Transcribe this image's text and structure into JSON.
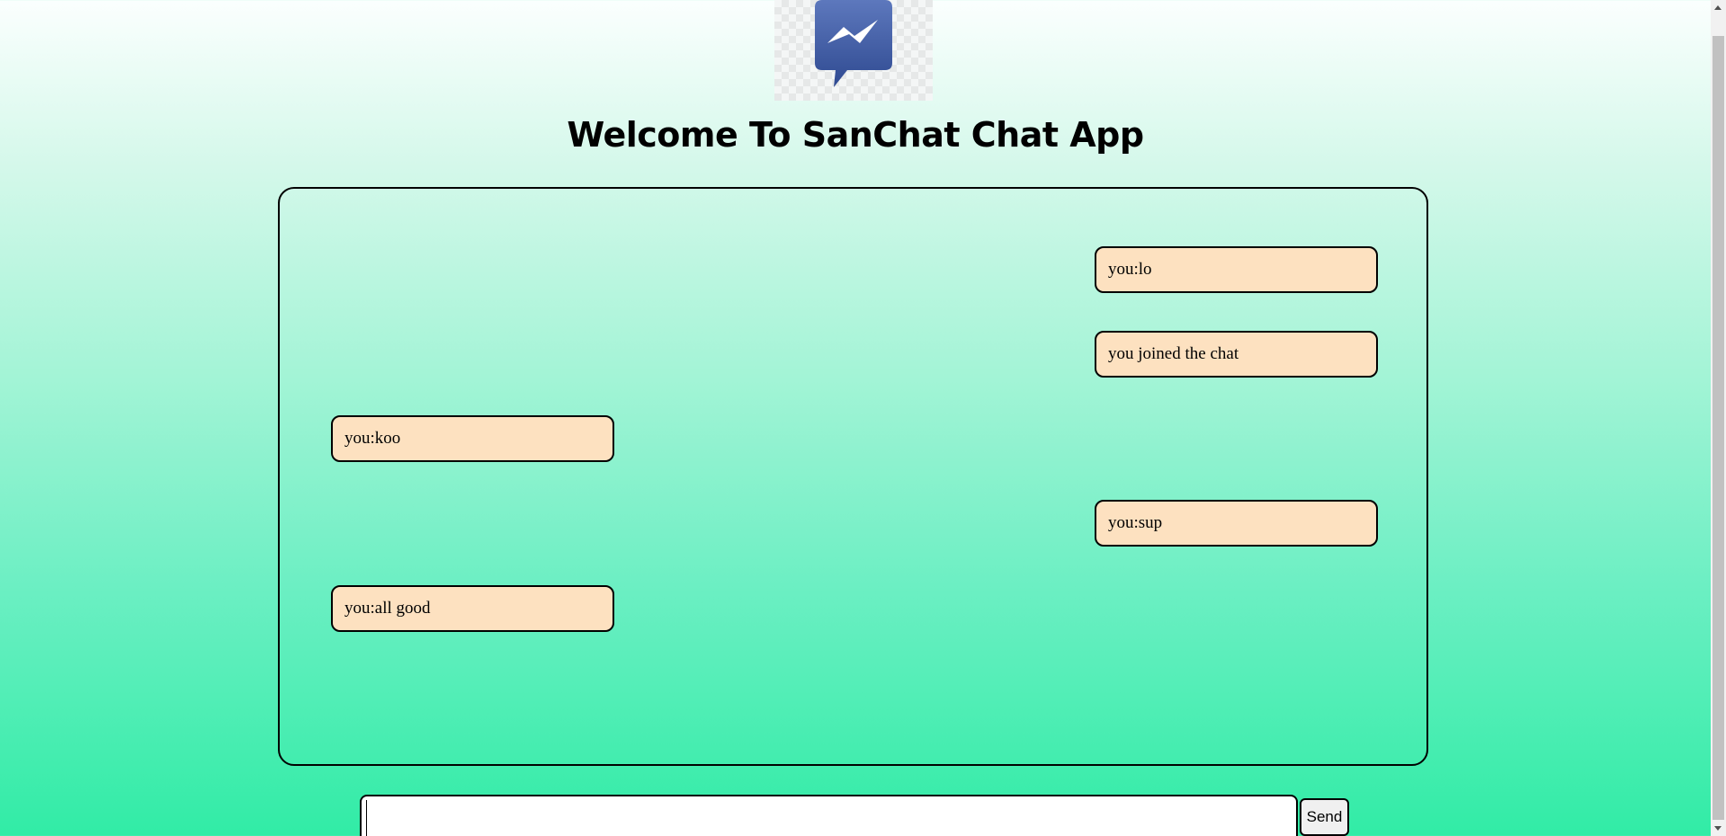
{
  "header": {
    "logo_icon": "messenger-lightning-chat-bubble-icon",
    "logo_color": "#3b5998",
    "title": "Welcome To SanChat Chat App"
  },
  "messages": [
    {
      "text": "you:lo",
      "side": "right"
    },
    {
      "text": "you joined the chat",
      "side": "right"
    },
    {
      "text": "you:koo",
      "side": "left"
    },
    {
      "text": "you:sup",
      "side": "right"
    },
    {
      "text": "you:all good",
      "side": "left"
    }
  ],
  "composer": {
    "value": "",
    "placeholder": "",
    "send_label": "Send"
  },
  "colors": {
    "bubble_background": "#fde1c0",
    "gradient_top": "#fbfffe",
    "gradient_bottom": "#31eca6"
  }
}
